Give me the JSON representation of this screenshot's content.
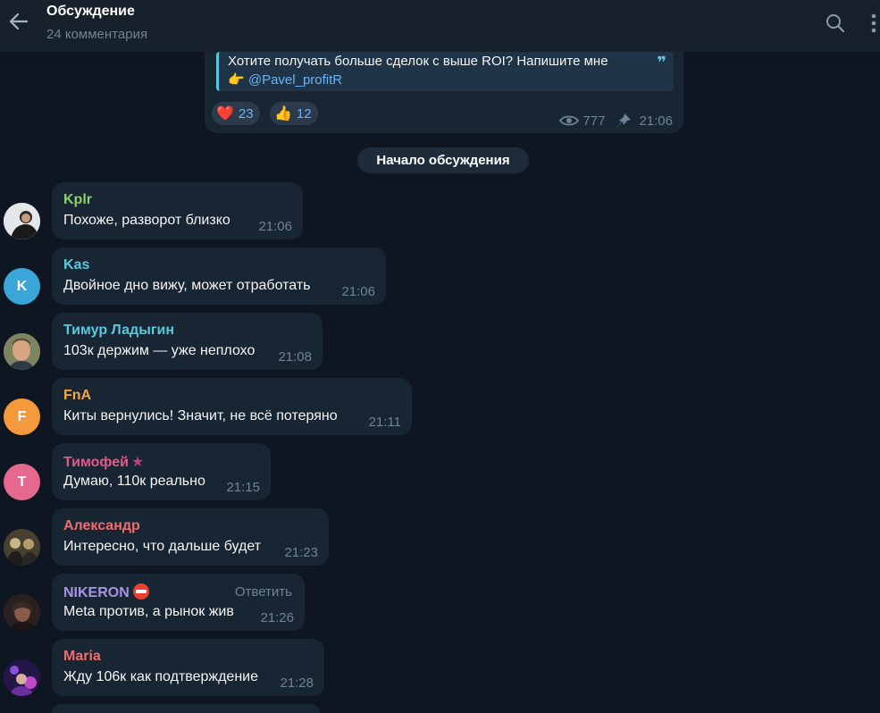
{
  "header": {
    "title": "Обсуждение",
    "subtitle": "24 комментария",
    "back_icon": "arrow-left-icon",
    "search_icon": "search-icon",
    "menu_icon": "more-vertical-icon"
  },
  "post": {
    "line1": "Хотите получать больше сделок с выше ROI? Напишите мне",
    "line2_emoji": "👉",
    "line2_link": "@Pavel_profitR",
    "reactions": [
      {
        "emoji": "❤️",
        "count": "23"
      },
      {
        "emoji": "👍",
        "count": "12"
      }
    ],
    "views": "777",
    "time": "21:06"
  },
  "discussion_start": "Начало обсуждения",
  "comments": [
    {
      "author": "Kplr",
      "text": "Похоже, разворот близко",
      "time": "21:06",
      "author_color": "#8ed26b",
      "avatar_letter": ""
    },
    {
      "author": "Kas",
      "text": "Двойное дно вижу, может отработать",
      "time": "21:06",
      "author_color": "#5ac8dd",
      "avatar_letter": "K"
    },
    {
      "author": "Тимур Ладыгин",
      "text": "103к держим — уже неплохо",
      "time": "21:08",
      "author_color": "#5ac8dd",
      "avatar_letter": ""
    },
    {
      "author": "FnA",
      "text": "Киты вернулись! Значит, не всё потеряно",
      "time": "21:11",
      "author_color": "#f6a544",
      "avatar_letter": "F"
    },
    {
      "author": "Тимофей",
      "text": "Думаю, 110к реально",
      "time": "21:15",
      "author_color": "#e05b8d",
      "avatar_letter": "T",
      "badge": "★"
    },
    {
      "author": "Александр",
      "text": "Интересно, что дальше будет",
      "time": "21:23",
      "author_color": "#ef6e6e",
      "avatar_letter": ""
    },
    {
      "author": "NIKERON",
      "text": "Meta против, а рынок жив",
      "time": "21:26",
      "author_color": "#a695e7",
      "avatar_letter": "",
      "reply_label": "Ответить"
    },
    {
      "author": "Maria",
      "text": "Жду 106к как подтверждение",
      "time": "21:28",
      "author_color": "#ef6e6e",
      "avatar_letter": ""
    }
  ],
  "colors": {
    "background": "#0e1621",
    "bubble": "#182533",
    "header": "#17212b",
    "link": "#6ab3f3",
    "meta": "#6f8396"
  }
}
